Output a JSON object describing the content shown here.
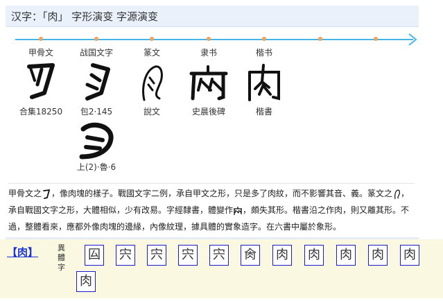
{
  "title": "汉字：「肉」 字形演变 字源演变",
  "stages": [
    {
      "era": "甲骨文",
      "source": "合集18250"
    },
    {
      "era": "战国文字",
      "source": "包2·145"
    },
    {
      "era": "篆文",
      "source": "說文"
    },
    {
      "era": "隶书",
      "source": "史晨後碑"
    },
    {
      "era": "楷书",
      "source": "楷書"
    }
  ],
  "extra_source": "上(2)·魯·6",
  "description": {
    "p1": "甲骨文之",
    "p2": "，像肉塊的樣子。戰國文字二例，承自甲文之形，只是多了肉紋，而不影響其音、義。篆文之",
    "p3": "，承自戰國文字之形，大體相似，少有改易。字經隸書，體變作",
    "p4": "，頗失其形。楷書沿之作肉，則又離其形。不過，整體看來，應都外像肉塊的邊緣，內像紋理，據具體的實象造字。在六書中屬於象形。"
  },
  "variants": {
    "head": "【肉】",
    "label": "異體字",
    "chars": [
      "囜",
      "宍",
      "宍",
      "宍",
      "宍",
      "肏",
      "肉",
      "肉",
      "肉",
      "肉",
      "肉",
      "肉"
    ]
  },
  "colors": {
    "timeline": "#45b5e8",
    "dots": "#f2a25a",
    "link": "#1a33d9",
    "variant_bg": "#fbf8e1"
  }
}
